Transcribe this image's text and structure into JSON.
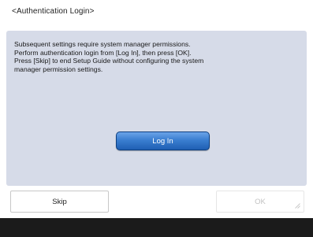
{
  "screen": {
    "title": "<Authentication Login>"
  },
  "message": {
    "lines": [
      "Subsequent settings require system manager permissions.",
      "Perform authentication login from [Log In], then press [OK].",
      "Press [Skip] to end Setup Guide without configuring the system",
      "manager permission settings."
    ]
  },
  "buttons": {
    "login_label": "Log In",
    "skip_label": "Skip",
    "ok_label": "OK"
  },
  "colors": {
    "panel_background": "#d6dbe8",
    "primary_button": "#3a7ed0",
    "disabled_text": "#c2c2c2",
    "bottom_band": "#1b1b1b"
  }
}
